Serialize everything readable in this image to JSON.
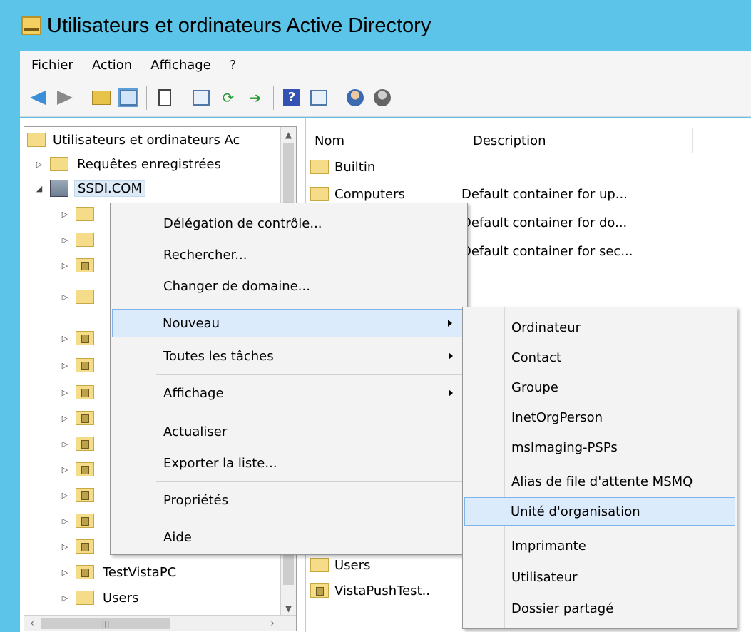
{
  "window": {
    "title": "Utilisateurs et ordinateurs Active Directory"
  },
  "menubar": {
    "items": [
      "Fichier",
      "Action",
      "Affichage",
      "?"
    ]
  },
  "toolbar": {
    "icons": [
      "back-icon",
      "forward-icon",
      "up-folder-icon",
      "show-hide-tree-icon",
      "properties-icon",
      "export-list-icon",
      "refresh-icon",
      "export-icon",
      "help-icon",
      "details-view-icon",
      "users-icon",
      "group-icon"
    ]
  },
  "tree": {
    "root": "Utilisateurs et ordinateurs Ac",
    "saved_queries": "Requêtes enregistrées",
    "domain": "SSDI.COM",
    "testvistapc": "TestVistaPC",
    "users": "Users",
    "partial": "VistaPushTest"
  },
  "list": {
    "columns": [
      "Nom",
      "Description"
    ],
    "rows": [
      {
        "name": "Builtin",
        "description": ""
      },
      {
        "name": "Computers",
        "description": "Default container for up..."
      },
      {
        "name": "",
        "description": "Default container for do..."
      },
      {
        "name": "",
        "description": "Default container for sec..."
      },
      {
        "name": "Users",
        "description": ""
      },
      {
        "name": "VistaPushTest..",
        "description": ""
      }
    ]
  },
  "context_menu": {
    "items": [
      {
        "label": "Délégation de contrôle...",
        "submenu": false
      },
      {
        "label": "Rechercher...",
        "submenu": false
      },
      {
        "label": "Changer de domaine...",
        "submenu": false
      },
      {
        "label": "Nouveau",
        "submenu": true,
        "highlighted": true
      },
      {
        "label": "Toutes les tâches",
        "submenu": true
      },
      {
        "label": "Affichage",
        "submenu": true
      },
      {
        "label": "Actualiser",
        "submenu": false
      },
      {
        "label": "Exporter la liste...",
        "submenu": false
      },
      {
        "label": "Propriétés",
        "submenu": false
      },
      {
        "label": "Aide",
        "submenu": false
      }
    ]
  },
  "submenu": {
    "items": [
      {
        "label": "Ordinateur"
      },
      {
        "label": "Contact"
      },
      {
        "label": "Groupe"
      },
      {
        "label": "InetOrgPerson"
      },
      {
        "label": "msImaging-PSPs"
      },
      {
        "label": "Alias de file d'attente MSMQ"
      },
      {
        "label": "Unité d'organisation",
        "highlighted": true
      },
      {
        "label": "Imprimante"
      },
      {
        "label": "Utilisateur"
      },
      {
        "label": "Dossier partagé"
      }
    ]
  }
}
